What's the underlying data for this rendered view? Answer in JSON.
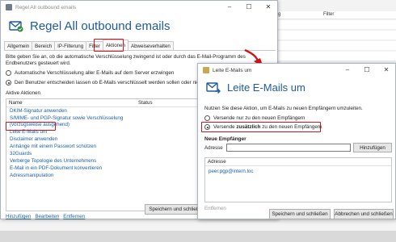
{
  "colors": {
    "accent": "#1e5a9c",
    "highlight": "#d0141a",
    "link": "#1a5fa8"
  },
  "background_app": {
    "columns": [
      "rg",
      "Filter"
    ]
  },
  "main_dialog": {
    "window_title": "Regel All outbound emails",
    "header_icon": "mail-rule-icon",
    "header_title": "Regel All outbound emails",
    "title_buttons": {
      "minimize": "–",
      "maximize": "☐",
      "close": "✕"
    },
    "tabs": [
      {
        "label": "Allgemein"
      },
      {
        "label": "Bereich"
      },
      {
        "label": "IP-Filterung"
      },
      {
        "label": "Filter"
      },
      {
        "label": "Aktionen",
        "active": true
      },
      {
        "label": "Abweiseverhalten"
      }
    ],
    "description": "Bitte geben Sie an, ob die automatische Verschlüsselung zwingend ist oder durch das E-Mail-Programm des Endbenutzers gesteuert wird.",
    "options": [
      {
        "label": "Automatische Verschlüsselung aller E-Mails auf dem Server erzwingen",
        "checked": false
      },
      {
        "label": "Den Benutzer entscheiden lassen ob E-Mails verschlüsselt werden sollen oder nicht",
        "checked": true
      }
    ],
    "actions_label": "Aktive Aktionen",
    "actions_columns": [
      "Name",
      "Status"
    ],
    "actions": [
      "DKIM-Signatur anwenden",
      "S/MIME- und PGP-Signatur sowie Verschlüsselung (vorzugsweise ausgehend)",
      "Leite E-Mails um",
      "Disclaimer anwenden",
      "Anhänge mit einem Passwort schützen",
      "32Guards",
      "Verberge Topologie des Unternehmens",
      "E-Mail in ein PDF-Dokument konvertieren",
      "Adressmanipulation"
    ],
    "links": [
      "Hinzufügen",
      "Bearbeiten",
      "Entfernen"
    ],
    "save_button": "Speichern und schließen"
  },
  "redirect_dialog": {
    "window_title": "Leite E-Mails um",
    "header_title": "Leite E-Mails um",
    "title_buttons": {
      "minimize": "–",
      "maximize": "☐",
      "close": "✕"
    },
    "description": "Nutzen Sie diese Aktion, um E-Mails zu neuen Empfängern umzuleiten.",
    "option_only": "Versende nur zu den neuen Empfängern",
    "option_additional_pre": "Versende ",
    "option_additional_bold": "zusätzlich",
    "option_additional_post": " zu den neuen Empfängern",
    "section": "Neue Empfänger",
    "address_label": "Adresse",
    "address_value": "",
    "add_button": "Hinzufügen",
    "list_header": "Adresse",
    "recipients": [
      "peer.pgp@intern.loc"
    ],
    "remove_link": "Entfernen",
    "save_button": "Speichern und schließen",
    "cancel_button": "Abbrechen und schließen"
  }
}
